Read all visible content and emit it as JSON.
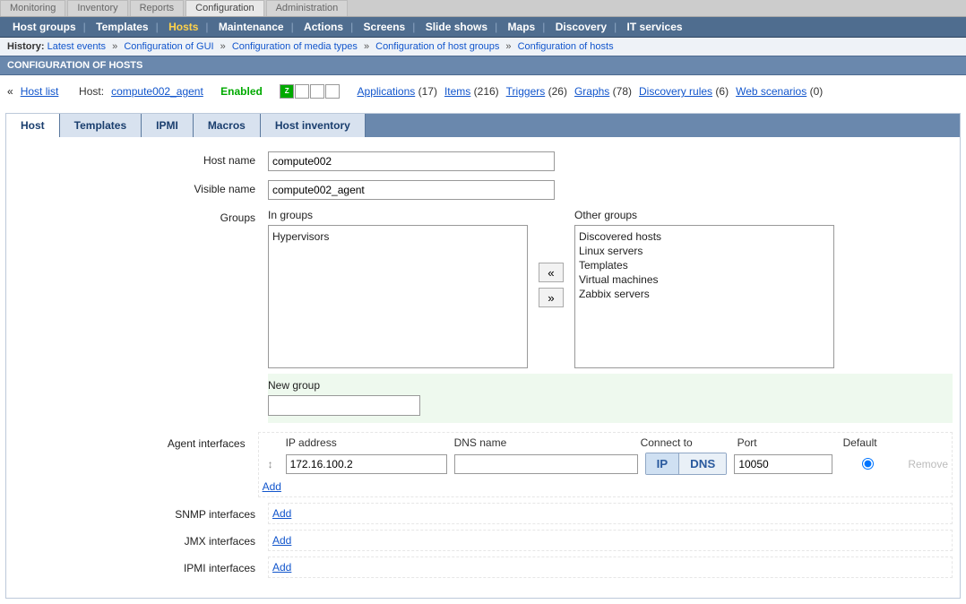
{
  "top_tabs": [
    "Monitoring",
    "Inventory",
    "Reports",
    "Configuration",
    "Administration"
  ],
  "top_tabs_selected": 3,
  "nav": {
    "items": [
      "Host groups",
      "Templates",
      "Hosts",
      "Maintenance",
      "Actions",
      "Screens",
      "Slide shows",
      "Maps",
      "Discovery",
      "IT services"
    ],
    "selected": 2
  },
  "history": {
    "label": "History:",
    "items": [
      "Latest events",
      "Configuration of GUI",
      "Configuration of media types",
      "Configuration of host groups",
      "Configuration of hosts"
    ]
  },
  "page_header": "CONFIGURATION OF HOSTS",
  "summary": {
    "back": "« ",
    "hostlist": "Host list",
    "host_label": "Host:",
    "host_link": "compute002_agent",
    "status": "Enabled",
    "links": [
      {
        "name": "Applications",
        "count": 17
      },
      {
        "name": "Items",
        "count": 216
      },
      {
        "name": "Triggers",
        "count": 26
      },
      {
        "name": "Graphs",
        "count": 78
      },
      {
        "name": "Discovery rules",
        "count": 6
      },
      {
        "name": "Web scenarios",
        "count": 0
      }
    ]
  },
  "tabs": [
    "Host",
    "Templates",
    "IPMI",
    "Macros",
    "Host inventory"
  ],
  "tabs_selected": 0,
  "form": {
    "hostname_label": "Host name",
    "hostname_value": "compute002",
    "visible_label": "Visible name",
    "visible_value": "compute002_agent",
    "groups_label": "Groups",
    "in_groups_label": "In groups",
    "in_groups": [
      "Hypervisors"
    ],
    "other_groups_label": "Other groups",
    "other_groups": [
      "Discovered hosts",
      "Linux servers",
      "Templates",
      "Virtual machines",
      "Zabbix servers"
    ],
    "move_left": "«",
    "move_right": "»",
    "new_group_label": "New group",
    "new_group_value": "",
    "interfaces": {
      "agent_label": "Agent interfaces",
      "snmp_label": "SNMP interfaces",
      "jmx_label": "JMX interfaces",
      "ipmi_label": "IPMI interfaces",
      "head_ip": "IP address",
      "head_dns": "DNS name",
      "head_connect": "Connect to",
      "head_port": "Port",
      "head_default": "Default",
      "agent": {
        "ip": "172.16.100.2",
        "dns": "",
        "port": "10050",
        "connect": "IP"
      },
      "btn_ip": "IP",
      "btn_dns": "DNS",
      "add": "Add",
      "remove": "Remove"
    }
  }
}
